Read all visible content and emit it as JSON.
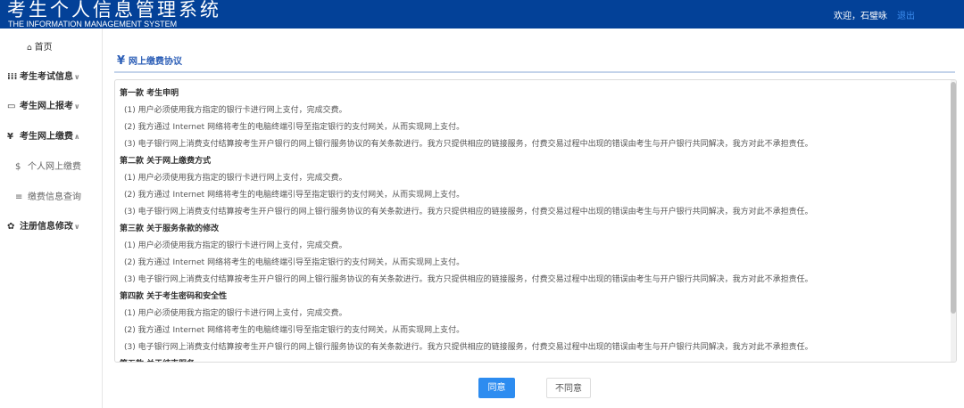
{
  "header": {
    "title": "考生个人信息管理系统",
    "subtitle": "THE INFORMATION MANAGEMENT SYSTEM",
    "welcome": "欢迎，石璧咏",
    "logout": "退出"
  },
  "sidebar": {
    "home": "首页",
    "items": [
      {
        "label": "考生考试信息",
        "icon": "grid-icon",
        "glyph": "⁞⁞⁞",
        "chev": "∨"
      },
      {
        "label": "考生网上报考",
        "icon": "monitor-icon",
        "glyph": "▭",
        "chev": "∨"
      },
      {
        "label": "考生网上缴费",
        "icon": "yen-icon",
        "glyph": "¥",
        "chev": "∧"
      },
      {
        "label": "注册信息修改",
        "icon": "gear-icon",
        "glyph": "✿",
        "chev": "∨"
      }
    ],
    "subitems": [
      {
        "label": "个人网上缴费",
        "glyph": "$"
      },
      {
        "label": "缴费信息查询",
        "glyph": "≡"
      }
    ]
  },
  "main": {
    "title_icon": "¥",
    "title": "网上缴费协议",
    "lines": [
      "第一款 考生申明",
      "(1) 用户必须使用我方指定的银行卡进行网上支付，完成交费。",
      "(2) 我方通过 Internet 网络将考生的电脑终端引导至指定银行的支付网关，从而实现网上支付。",
      "(3) 电子银行网上消费支付结算按考生开户银行的网上银行服务协议的有关条款进行。我方只提供相应的链接服务，付费交易过程中出现的错误由考生与开户银行共同解决，我方对此不承担责任。",
      "第二款 关于网上缴费方式",
      "(1) 用户必须使用我方指定的银行卡进行网上支付，完成交费。",
      "(2) 我方通过 Internet 网络将考生的电脑终端引导至指定银行的支付网关，从而实现网上支付。",
      "(3) 电子银行网上消费支付结算按考生开户银行的网上银行服务协议的有关条款进行。我方只提供相应的链接服务，付费交易过程中出现的错误由考生与开户银行共同解决，我方对此不承担责任。",
      "第三款 关于服务条款的修改",
      "(1) 用户必须使用我方指定的银行卡进行网上支付，完成交费。",
      "(2) 我方通过 Internet 网络将考生的电脑终端引导至指定银行的支付网关，从而实现网上支付。",
      "(3) 电子银行网上消费支付结算按考生开户银行的网上银行服务协议的有关条款进行。我方只提供相应的链接服务，付费交易过程中出现的错误由考生与开户银行共同解决，我方对此不承担责任。",
      "第四款 关于考生密码和安全性",
      "(1) 用户必须使用我方指定的银行卡进行网上支付，完成交费。",
      "(2) 我方通过 Internet 网络将考生的电脑终端引导至指定银行的支付网关，从而实现网上支付。",
      "(3) 电子银行网上消费支付结算按考生开户银行的网上银行服务协议的有关条款进行。我方只提供相应的链接服务，付费交易过程中出现的错误由考生与开户银行共同解决，我方对此不承担责任。",
      "第五款 关于结束服务"
    ],
    "agree": "同意",
    "disagree": "不同意"
  }
}
